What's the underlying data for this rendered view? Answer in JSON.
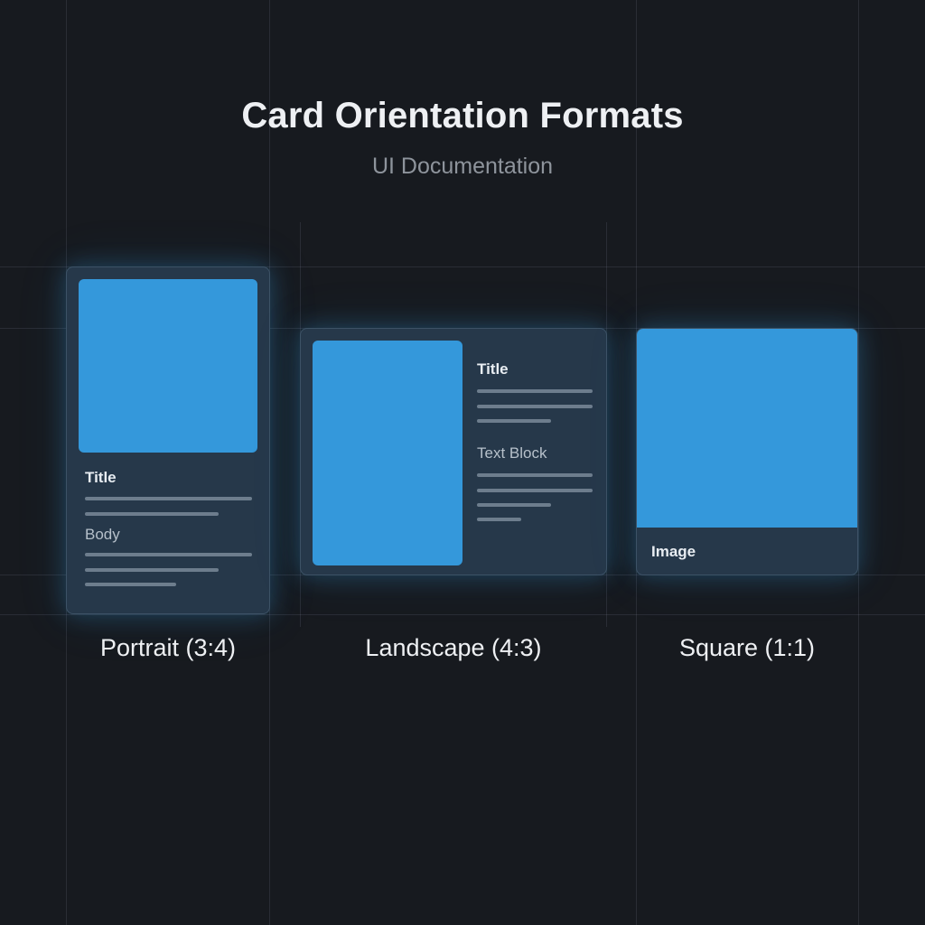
{
  "header": {
    "title": "Card Orientation Formats",
    "subtitle": "UI Documentation"
  },
  "colors": {
    "background": "#171a1f",
    "card": "#26384a",
    "image": "#3498db",
    "placeholder_line": "#6d7d8d"
  },
  "cards": {
    "portrait": {
      "title": "Title",
      "body": "Body",
      "caption": "Portrait (3:4)"
    },
    "landscape": {
      "title": "Title",
      "text_block": "Text Block",
      "caption": "Landscape (4:3)"
    },
    "square": {
      "image_label": "Image",
      "caption": "Square (1:1)"
    }
  }
}
